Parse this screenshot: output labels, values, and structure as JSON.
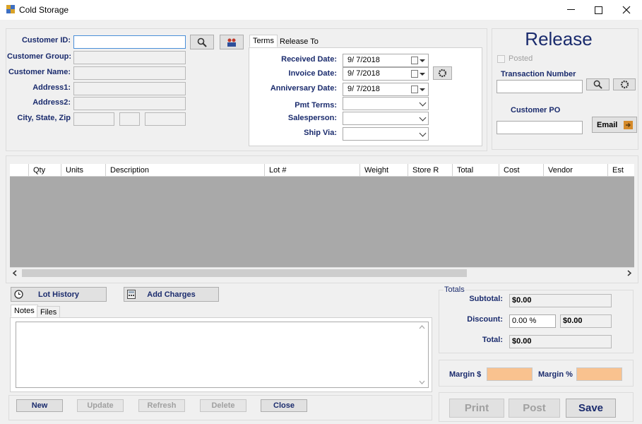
{
  "window": {
    "title": "Cold Storage",
    "minimize": "—",
    "maximize": "☐",
    "close": "✕"
  },
  "customer": {
    "id_label": "Customer ID:",
    "id_value": "",
    "group_label": "Customer Group:",
    "name_label": "Customer Name:",
    "address1_label": "Address1:",
    "address2_label": "Address2:",
    "city_state_zip_label": "City, State, Zip"
  },
  "terms": {
    "tabs": [
      "Terms",
      "Release To"
    ],
    "received_date_label": "Received Date:",
    "received_date": "9/ 7/2018",
    "invoice_date_label": "Invoice Date:",
    "invoice_date": "9/ 7/2018",
    "anniversary_date_label": "Anniversary  Date:",
    "anniversary_date": "9/ 7/2018",
    "pmt_terms_label": "Pmt Terms:",
    "salesperson_label": "Salesperson:",
    "ship_via_label": "Ship Via:"
  },
  "release": {
    "heading": "Release",
    "posted_label": "Posted",
    "transaction_number_label": "Transaction Number",
    "customer_po_label": "Customer PO",
    "email_label": "Email"
  },
  "grid": {
    "columns": [
      "Qty",
      "Units",
      "Description",
      "Lot #",
      "Weight",
      "Store R",
      "Total",
      "Cost",
      "Vendor",
      "Est"
    ]
  },
  "actions": {
    "lot_history": "Lot History",
    "add_charges": "Add Charges",
    "notes_tabs": [
      "Notes",
      "Files"
    ],
    "new": "New",
    "update": "Update",
    "refresh": "Refresh",
    "delete": "Delete",
    "close": "Close"
  },
  "totals": {
    "group_label": "Totals",
    "subtotal_label": "Subtotal:",
    "subtotal_value": "$0.00",
    "discount_label": "Discount:",
    "discount_percent": "0.00 %",
    "discount_value": "$0.00",
    "total_label": "Total:",
    "total_value": "$0.00"
  },
  "margin": {
    "dollar_label": "Margin $",
    "percent_label": "Margin %",
    "color": "#f9c28f"
  },
  "footer": {
    "print": "Print",
    "post": "Post",
    "save": "Save"
  }
}
